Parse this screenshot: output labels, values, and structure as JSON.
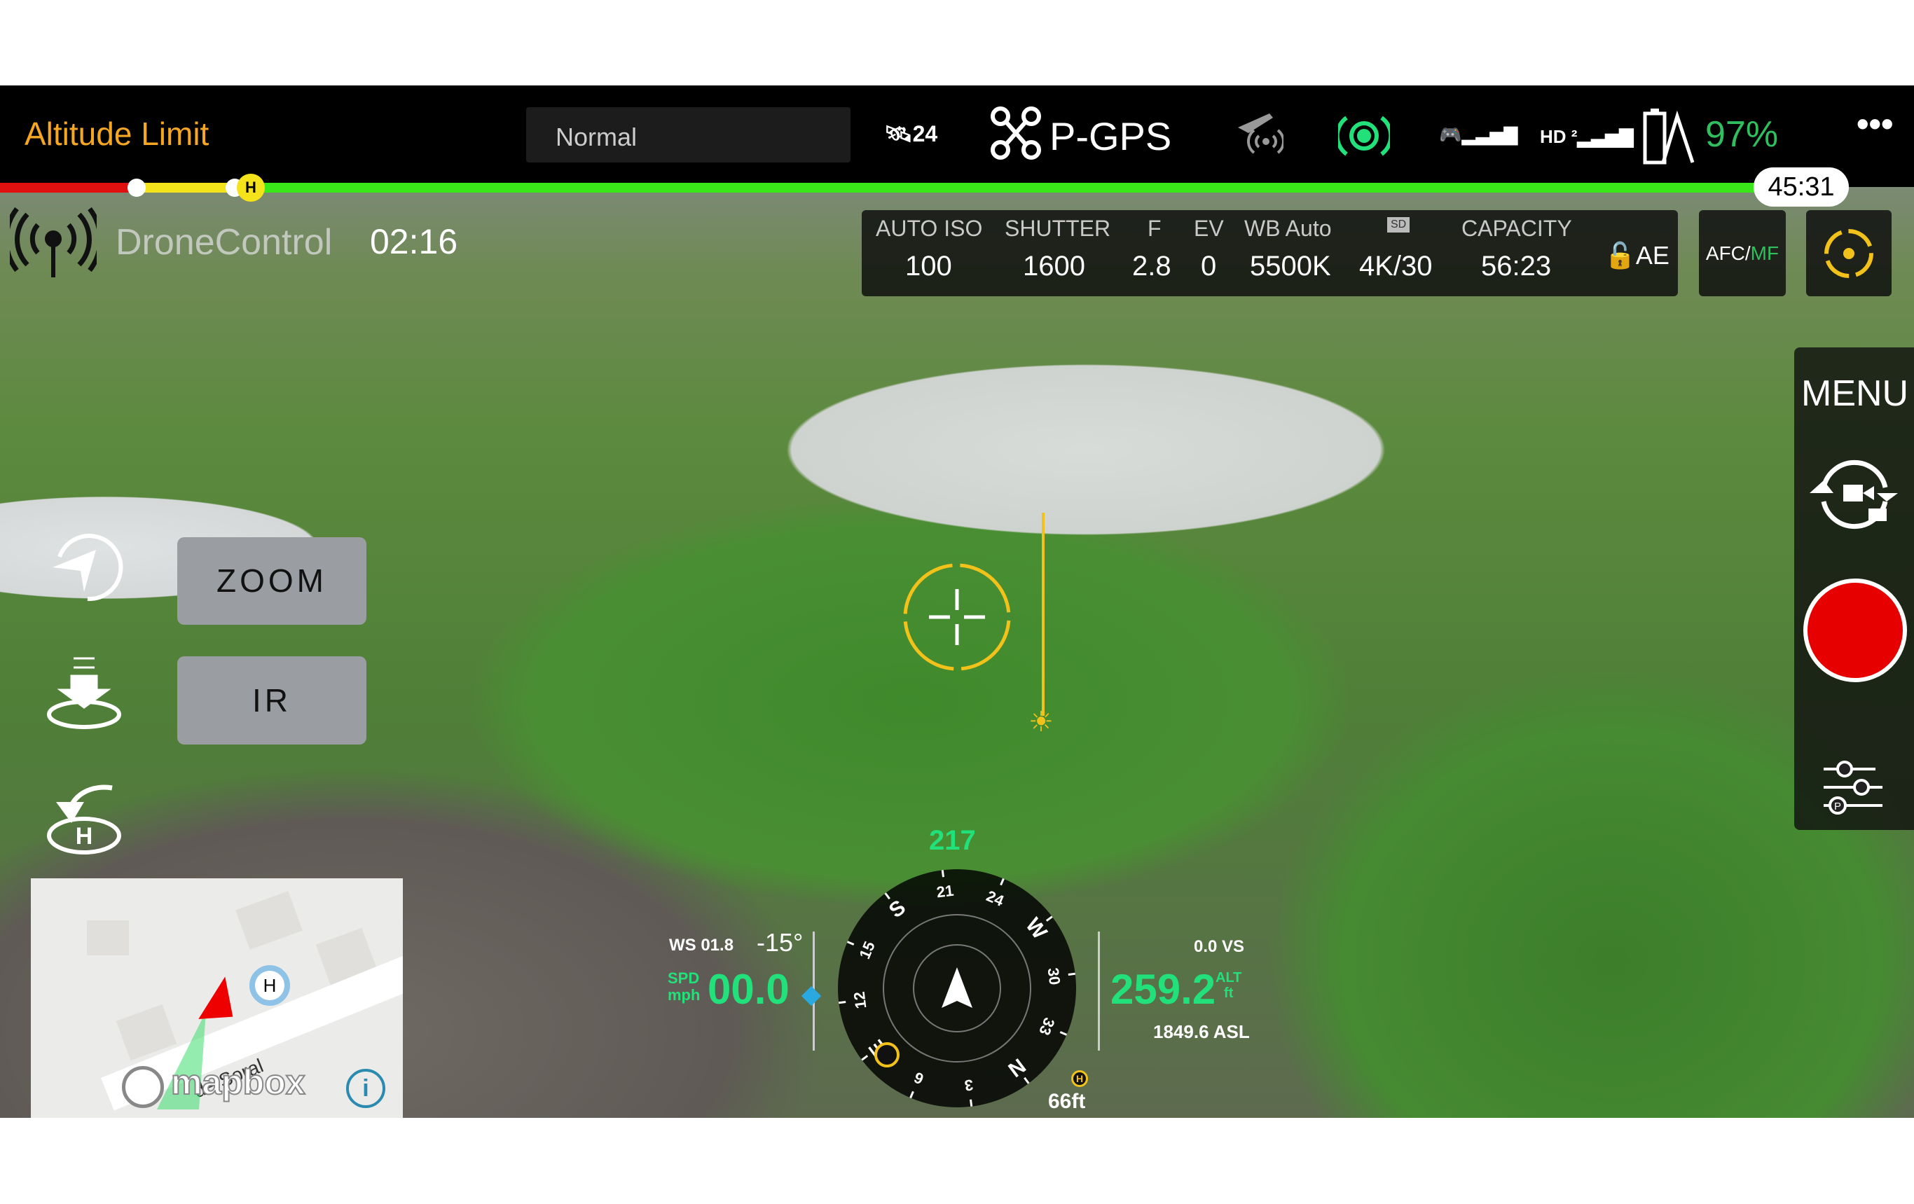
{
  "topbar": {
    "mode_title": "Altitude Limit",
    "flight_mode_select": "Normal",
    "satellites": "24",
    "gps_mode": "P-GPS",
    "battery": "97%",
    "more_icon": "more-icon"
  },
  "timeline": {
    "remaining_time": "45:31",
    "home_marker": "H"
  },
  "link": {
    "app_name": "DroneControl",
    "elapsed": "02:16"
  },
  "camera": {
    "labels": [
      "AUTO ISO",
      "SHUTTER",
      "F",
      "EV",
      "WB Auto",
      "SD",
      "CAPACITY"
    ],
    "values": [
      "100",
      "1600",
      "2.8",
      "0",
      "5500K",
      "4K/30",
      "56:23"
    ],
    "ae": "AE",
    "afc": "AFC/",
    "mf": "MF"
  },
  "right_panel": {
    "menu": "MENU"
  },
  "left": {
    "zoom": "ZOOM",
    "ir": "IR"
  },
  "telemetry": {
    "heading": "217",
    "ws": "WS 01.8",
    "pitch": "-15°",
    "spd_label": "SPD",
    "spd_unit": "mph",
    "speed": "00.0",
    "vs": "0.0 VS",
    "altitude": "259.2",
    "alt_label": "ALT",
    "alt_unit": "ft",
    "asl": "1849.6 ASL",
    "home_distance": "66ft",
    "home": "H"
  },
  "compass": {
    "labels": [
      "S",
      "21",
      "24",
      "W",
      "30",
      "33",
      "N",
      "3",
      "6",
      "E",
      "12",
      "15"
    ]
  },
  "map": {
    "street": "de Soral",
    "home": "H",
    "attribution": "mapbox",
    "info": "i"
  },
  "colors": {
    "accent_green": "#22e07a",
    "orange": "#f5a623",
    "record": "#e60000",
    "yellow": "#f2c21b"
  }
}
